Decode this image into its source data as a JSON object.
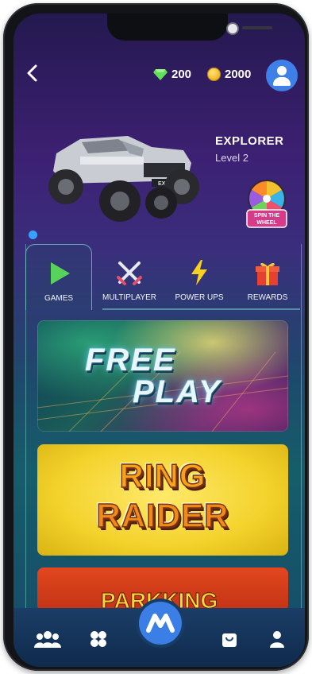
{
  "header": {
    "back_label": "<",
    "gems": "200",
    "coins": "2000"
  },
  "vehicle": {
    "name": "EXPLORER",
    "level": "Level 2"
  },
  "spin_wheel": {
    "label_line1": "SPIN THE",
    "label_line2": "WHEEL"
  },
  "tabs": [
    {
      "label": "GAMES",
      "icon": "play-icon",
      "active": true
    },
    {
      "label": "MULTIPLAYER",
      "icon": "crossed-swords-icon",
      "active": false
    },
    {
      "label": "POWER UPS",
      "icon": "lightning-icon",
      "active": false
    },
    {
      "label": "REWARDS",
      "icon": "gift-icon",
      "active": false
    }
  ],
  "games": {
    "free_play": {
      "line1": "FREE",
      "line2": "PLAY"
    },
    "ring_raider": {
      "line1": "RING",
      "line2": "RAIDER"
    },
    "park_king": {
      "text": "PARKKING"
    }
  },
  "bottom_nav": {
    "items": [
      "community-icon",
      "grid-icon",
      "home-logo-icon",
      "shop-icon",
      "profile-icon"
    ],
    "home_logo_letter": "M"
  },
  "colors": {
    "accent_blue": "#3b7fe6",
    "gem_green": "#5fe05a",
    "coin_gold": "#f0b21a",
    "ring_yellow": "#f3d22b"
  }
}
